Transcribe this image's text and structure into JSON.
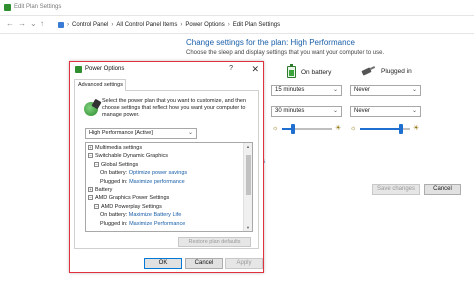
{
  "window": {
    "title": "Edit Plan Settings"
  },
  "nav": {
    "back": "←",
    "forward": "→",
    "up": "↑",
    "breadcrumb": [
      "Control Panel",
      "All Control Panel Items",
      "Power Options",
      "Edit Plan Settings"
    ]
  },
  "main": {
    "heading": "Change settings for the plan: High Performance",
    "subheading": "Choose the sleep and display settings that you want your computer to use.",
    "on_battery_label": "On battery",
    "plugged_in_label": "Plugged in",
    "display_off": {
      "battery": "15 minutes",
      "plugged": "Never"
    },
    "sleep": {
      "battery": "30 minutes",
      "plugged": "Never"
    },
    "brightness": {
      "battery": 0.2,
      "plugged": 0.85
    },
    "partial_link": "s",
    "save_button": "Save changes",
    "cancel_button": "Cancel"
  },
  "dialog": {
    "title": "Power Options",
    "help": "?",
    "close": "✕",
    "tab": "Advanced settings",
    "intro": "Select the power plan that you want to customize, and then choose settings that reflect how you want your computer to manage power.",
    "plan": "High Performance [Active]",
    "tree": [
      {
        "toggle": "+",
        "label": "Multimedia settings",
        "value": "",
        "level": 0
      },
      {
        "toggle": "−",
        "label": "Switchable Dynamic Graphics",
        "value": "",
        "level": 0
      },
      {
        "toggle": "−",
        "label": "Global Settings",
        "value": "",
        "level": 1
      },
      {
        "toggle": "",
        "label": "On battery:",
        "value": "Optimize power savings",
        "level": 2
      },
      {
        "toggle": "",
        "label": "Plugged in:",
        "value": "Maximize performance",
        "level": 2
      },
      {
        "toggle": "+",
        "label": "Battery",
        "value": "",
        "level": 0
      },
      {
        "toggle": "−",
        "label": "AMD Graphics Power Settings",
        "value": "",
        "level": 0
      },
      {
        "toggle": "−",
        "label": "AMD Powerplay Settings",
        "value": "",
        "level": 1
      },
      {
        "toggle": "",
        "label": "On battery:",
        "value": "Maximize Battery Life",
        "level": 2
      },
      {
        "toggle": "",
        "label": "Plugged in:",
        "value": "Maximize Performance",
        "level": 2
      }
    ],
    "restore_button": "Restore plan defaults",
    "ok_button": "OK",
    "cancel_button": "Cancel",
    "apply_button": "Apply"
  }
}
